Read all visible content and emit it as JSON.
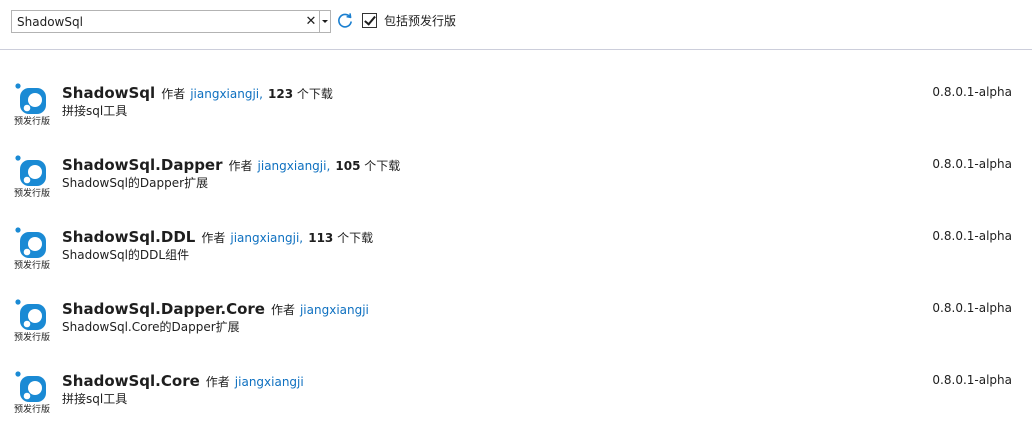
{
  "search": {
    "value": "ShadowSql",
    "clear_glyph": "✕"
  },
  "prerelease": {
    "label": "包括预发行版",
    "checked": true
  },
  "author_label": "作者",
  "packages": [
    {
      "name": "ShadowSql",
      "author": "jiangxiangji,",
      "downloads": "123",
      "downloads_suffix": " 个下载",
      "description": "拼接sql工具",
      "version": "0.8.0.1-alpha",
      "badge": "预发行版"
    },
    {
      "name": "ShadowSql.Dapper",
      "author": "jiangxiangji,",
      "downloads": "105",
      "downloads_suffix": " 个下载",
      "description": "ShadowSql的Dapper扩展",
      "version": "0.8.0.1-alpha",
      "badge": "预发行版"
    },
    {
      "name": "ShadowSql.DDL",
      "author": "jiangxiangji,",
      "downloads": "113",
      "downloads_suffix": " 个下载",
      "description": "ShadowSql的DDL组件",
      "version": "0.8.0.1-alpha",
      "badge": "预发行版"
    },
    {
      "name": "ShadowSql.Dapper.Core",
      "author": "jiangxiangji",
      "downloads": "",
      "downloads_suffix": "",
      "description": "ShadowSql.Core的Dapper扩展",
      "version": "0.8.0.1-alpha",
      "badge": "预发行版"
    },
    {
      "name": "ShadowSql.Core",
      "author": "jiangxiangji",
      "downloads": "",
      "downloads_suffix": "",
      "description": "拼接sql工具",
      "version": "0.8.0.1-alpha",
      "badge": "预发行版"
    }
  ],
  "colors": {
    "link": "#0e70c0",
    "icon_blue": "#1a8ad4",
    "border": "#cccedb"
  }
}
